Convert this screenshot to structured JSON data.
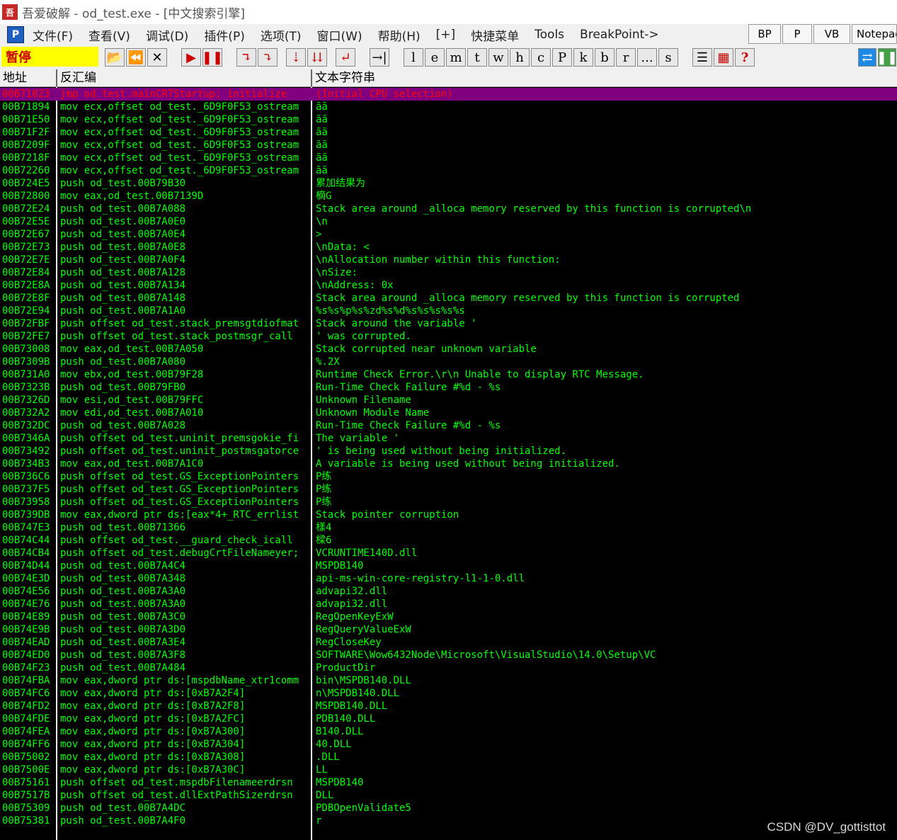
{
  "window": {
    "title": "吾爱破解 - od_test.exe - [中文搜索引擎]",
    "icon": "吾"
  },
  "menu": {
    "p_icon": "P",
    "items": [
      "文件(F)",
      "查看(V)",
      "调试(D)",
      "插件(P)",
      "选项(T)",
      "窗口(W)",
      "帮助(H)",
      "[+]",
      "快捷菜单",
      "Tools",
      "BreakPoint->"
    ],
    "right_buttons": [
      "BP",
      "P",
      "VB",
      "Notepad"
    ]
  },
  "toolbar": {
    "status": "暂停",
    "buttons": [
      "open",
      "rewind",
      "close",
      "run",
      "pause",
      "step-into",
      "step-over",
      "trace-into",
      "trace-over",
      "execute-till-return",
      "go-to",
      "l",
      "e",
      "m",
      "t",
      "w",
      "h",
      "c",
      "P",
      "k",
      "b",
      "r",
      "...",
      "s",
      "list",
      "grid",
      "help"
    ],
    "letters": [
      "l",
      "e",
      "m",
      "t",
      "w",
      "h",
      "c",
      "P",
      "k",
      "b",
      "r",
      "...",
      "s"
    ],
    "help": "?"
  },
  "columns": {
    "addr": "地址",
    "disasm": "反汇编",
    "str": "文本字符串"
  },
  "rows": [
    {
      "a": "00B71023",
      "d": "jmp od_test.mainCRTStartup; initialize",
      "s": "(Initial CPU selection)"
    },
    {
      "a": "00B71894",
      "d": "mov ecx,offset od_test._6D9F0F53_ostream",
      "s": "ãã"
    },
    {
      "a": "00B71E50",
      "d": "mov ecx,offset od_test._6D9F0F53_ostream",
      "s": "ãã"
    },
    {
      "a": "00B71F2F",
      "d": "mov ecx,offset od_test._6D9F0F53_ostream",
      "s": "ãã"
    },
    {
      "a": "00B7209F",
      "d": "mov ecx,offset od_test._6D9F0F53_ostream",
      "s": "ãã"
    },
    {
      "a": "00B7218F",
      "d": "mov ecx,offset od_test._6D9F0F53_ostream",
      "s": "ãã"
    },
    {
      "a": "00B72260",
      "d": "mov ecx,offset od_test._6D9F0F53_ostream",
      "s": "ãã"
    },
    {
      "a": "00B724E5",
      "d": "push od_test.00B79B30",
      "s": "累加结果为"
    },
    {
      "a": "00B72800",
      "d": "mov eax,od_test.00B7139D",
      "s": "樀G"
    },
    {
      "a": "00B72E24",
      "d": "push od_test.00B7A088",
      "s": "Stack area around _alloca memory reserved by this function is corrupted\\n"
    },
    {
      "a": "00B72E5E",
      "d": "push od_test.00B7A0E0",
      "s": "\\n"
    },
    {
      "a": "00B72E67",
      "d": "push od_test.00B7A0E4",
      "s": ">"
    },
    {
      "a": "00B72E73",
      "d": "push od_test.00B7A0E8",
      "s": "\\nData: <"
    },
    {
      "a": "00B72E7E",
      "d": "push od_test.00B7A0F4",
      "s": "\\nAllocation number within this function:"
    },
    {
      "a": "00B72E84",
      "d": "push od_test.00B7A128",
      "s": "\\nSize:"
    },
    {
      "a": "00B72E8A",
      "d": "push od_test.00B7A134",
      "s": "\\nAddress: 0x"
    },
    {
      "a": "00B72E8F",
      "d": "push od_test.00B7A148",
      "s": "Stack area around _alloca memory reserved by this function is corrupted"
    },
    {
      "a": "00B72E94",
      "d": "push od_test.00B7A1A0",
      "s": "%s%s%p%s%zd%s%d%s%s%s%s%s"
    },
    {
      "a": "00B72FBF",
      "d": "push offset od_test.stack_premsgtdiofmat",
      "s": "Stack around the variable '"
    },
    {
      "a": "00B72FE7",
      "d": "push offset od_test.stack_postmsgr_call",
      "s": "' was corrupted."
    },
    {
      "a": "00B73008",
      "d": "mov eax,od_test.00B7A050",
      "s": "Stack corrupted near unknown variable"
    },
    {
      "a": "00B7309B",
      "d": "push od_test.00B7A080",
      "s": "%.2X"
    },
    {
      "a": "00B731A0",
      "d": "mov ebx,od_test.00B79F28",
      "s": "Runtime Check Error.\\r\\n Unable to display RTC Message."
    },
    {
      "a": "00B7323B",
      "d": "push od_test.00B79FB0",
      "s": "Run-Time Check Failure #%d - %s"
    },
    {
      "a": "00B7326D",
      "d": "mov esi,od_test.00B79FFC",
      "s": "Unknown Filename"
    },
    {
      "a": "00B732A2",
      "d": "mov edi,od_test.00B7A010",
      "s": "Unknown Module Name"
    },
    {
      "a": "00B732DC",
      "d": "push od_test.00B7A028",
      "s": "Run-Time Check Failure #%d - %s"
    },
    {
      "a": "00B7346A",
      "d": "push offset od_test.uninit_premsgokie_fi",
      "s": "The variable '"
    },
    {
      "a": "00B73492",
      "d": "push offset od_test.uninit_postmsgatorce",
      "s": "' is being used without being initialized."
    },
    {
      "a": "00B734B3",
      "d": "mov eax,od_test.00B7A1C0",
      "s": "A variable is being used without being initialized."
    },
    {
      "a": "00B736C6",
      "d": "push offset od_test.GS_ExceptionPointers",
      "s": "P练"
    },
    {
      "a": "00B737F5",
      "d": "push offset od_test.GS_ExceptionPointers",
      "s": "P练"
    },
    {
      "a": "00B73958",
      "d": "push offset od_test.GS_ExceptionPointers",
      "s": "P练"
    },
    {
      "a": "00B739DB",
      "d": "mov eax,dword ptr ds:[eax*4+_RTC_errlist",
      "s": "Stack pointer corruption"
    },
    {
      "a": "00B747E3",
      "d": "push od_test.00B71366",
      "s": "樣4"
    },
    {
      "a": "00B74C44",
      "d": "push offset od_test.__guard_check_icall",
      "s": "樑6"
    },
    {
      "a": "00B74CB4",
      "d": "push offset od_test.debugCrtFileNameyer;",
      "s": "VCRUNTIME140D.dll"
    },
    {
      "a": "00B74D44",
      "d": "push od_test.00B7A4C4",
      "s": "MSPDB140"
    },
    {
      "a": "00B74E3D",
      "d": "push od_test.00B7A348",
      "s": "api-ms-win-core-registry-l1-1-0.dll"
    },
    {
      "a": "00B74E56",
      "d": "push od_test.00B7A3A0",
      "s": "advapi32.dll"
    },
    {
      "a": "00B74E76",
      "d": "push od_test.00B7A3A0",
      "s": "advapi32.dll"
    },
    {
      "a": "00B74E89",
      "d": "push od_test.00B7A3C0",
      "s": "RegOpenKeyExW"
    },
    {
      "a": "00B74E9B",
      "d": "push od_test.00B7A3D0",
      "s": "RegQueryValueExW"
    },
    {
      "a": "00B74EAD",
      "d": "push od_test.00B7A3E4",
      "s": "RegCloseKey"
    },
    {
      "a": "00B74ED0",
      "d": "push od_test.00B7A3F8",
      "s": "SOFTWARE\\Wow6432Node\\Microsoft\\VisualStudio\\14.0\\Setup\\VC"
    },
    {
      "a": "00B74F23",
      "d": "push od_test.00B7A484",
      "s": "ProductDir"
    },
    {
      "a": "00B74FBA",
      "d": "mov eax,dword ptr ds:[mspdbName_xtr1comm",
      "s": "bin\\MSPDB140.DLL"
    },
    {
      "a": "00B74FC6",
      "d": "mov eax,dword ptr ds:[0xB7A2F4]",
      "s": "n\\MSPDB140.DLL"
    },
    {
      "a": "00B74FD2",
      "d": "mov eax,dword ptr ds:[0xB7A2F8]",
      "s": "MSPDB140.DLL"
    },
    {
      "a": "00B74FDE",
      "d": "mov eax,dword ptr ds:[0xB7A2FC]",
      "s": "PDB140.DLL"
    },
    {
      "a": "00B74FEA",
      "d": "mov eax,dword ptr ds:[0xB7A300]",
      "s": "B140.DLL"
    },
    {
      "a": "00B74FF6",
      "d": "mov eax,dword ptr ds:[0xB7A304]",
      "s": "40.DLL"
    },
    {
      "a": "00B75002",
      "d": "mov eax,dword ptr ds:[0xB7A308]",
      "s": ".DLL"
    },
    {
      "a": "00B7500E",
      "d": "mov eax,dword ptr ds:[0xB7A30C]",
      "s": "LL"
    },
    {
      "a": "00B75161",
      "d": "push offset od_test.mspdbFilenameerdrsn",
      "s": "MSPDB140"
    },
    {
      "a": "00B7517B",
      "d": "push offset od_test.dllExtPathSizerdrsn",
      "s": "DLL"
    },
    {
      "a": "00B75309",
      "d": "push od_test.00B7A4DC",
      "s": "PDBOpenValidate5"
    },
    {
      "a": "00B75381",
      "d": "push od_test.00B7A4F0",
      "s": "r"
    }
  ],
  "watermark": "CSDN @DV_gottisttot",
  "colors": {
    "bg": "#000000",
    "text": "#00ff00",
    "selected_bg": "#800080",
    "selected_text": "#ff0000",
    "status_bg": "#ffff00"
  }
}
